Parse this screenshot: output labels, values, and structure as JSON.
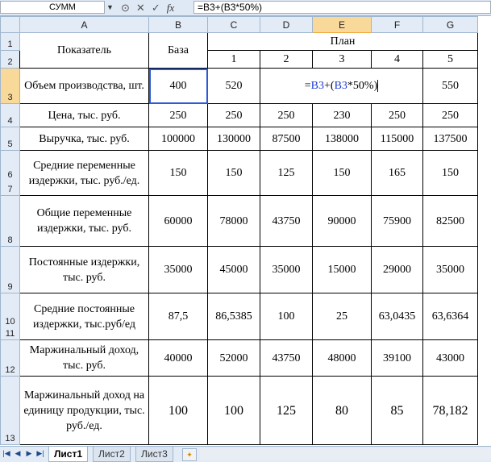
{
  "formula_bar": {
    "name_box": "СУММ",
    "formula": "=B3+(B3*50%)",
    "cancel_icon": "✕",
    "enter_icon": "✓",
    "fx_label": "fx"
  },
  "columns": [
    "A",
    "B",
    "C",
    "D",
    "E",
    "F",
    "G"
  ],
  "rows": [
    "1",
    "2",
    "3",
    "4",
    "5",
    "6",
    "7",
    "8",
    "9",
    "10",
    "11",
    "12",
    "13"
  ],
  "header": {
    "indicator": "Показатель",
    "base": "База",
    "plan": "План",
    "plan_numbers": [
      "1",
      "2",
      "3",
      "4",
      "5"
    ]
  },
  "editing_cell": {
    "prefix": "=",
    "ref1": "B3",
    "op": "+(",
    "ref2": "B3",
    "rest": "*50%)"
  },
  "table": [
    {
      "label": "Объем производства, шт.",
      "values": [
        "400",
        "520",
        "",
        "",
        "",
        "550"
      ]
    },
    {
      "label": "Цена, тыс. руб.",
      "values": [
        "250",
        "250",
        "250",
        "230",
        "250",
        "250"
      ]
    },
    {
      "label": "Выручка, тыс. руб.",
      "values": [
        "100000",
        "130000",
        "87500",
        "138000",
        "115000",
        "137500"
      ]
    },
    {
      "label": "Средние переменные издержки, тыс. руб./ед.",
      "values": [
        "150",
        "150",
        "125",
        "150",
        "165",
        "150"
      ]
    },
    {
      "label": "Общие переменные издержки, тыс. руб.",
      "values": [
        "60000",
        "78000",
        "43750",
        "90000",
        "75900",
        "82500"
      ]
    },
    {
      "label": "Постоянные издержки, тыс. руб.",
      "values": [
        "35000",
        "45000",
        "35000",
        "15000",
        "29000",
        "35000"
      ]
    },
    {
      "label": "Средние постоянные издержки, тыс.руб/ед",
      "values": [
        "87,5",
        "86,5385",
        "100",
        "25",
        "63,0435",
        "63,6364"
      ]
    },
    {
      "label": "Маржинальный доход, тыс. руб.",
      "values": [
        "40000",
        "52000",
        "43750",
        "48000",
        "39100",
        "43000"
      ]
    },
    {
      "label": "Маржинальный доход на единицу продукции, тыс. руб./ед.",
      "values": [
        "100",
        "100",
        "125",
        "80",
        "85",
        "78,182"
      ]
    }
  ],
  "sheet_tabs": [
    "Лист1",
    "Лист2",
    "Лист3"
  ]
}
